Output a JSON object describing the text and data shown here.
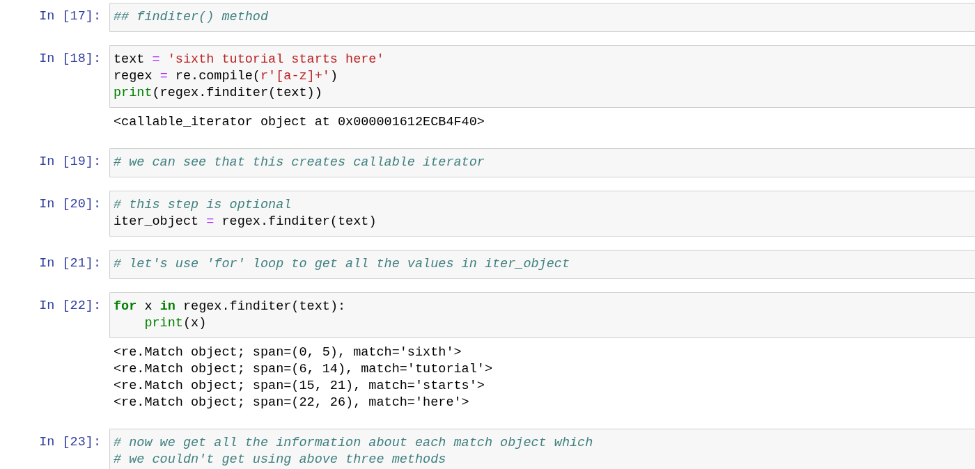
{
  "cells": [
    {
      "prompt": "In [17]:",
      "input": [
        [
          {
            "kind": "comment",
            "text": "## finditer() method"
          }
        ]
      ]
    },
    {
      "prompt": "In [18]:",
      "input": [
        [
          {
            "kind": "name",
            "text": "text "
          },
          {
            "kind": "operator",
            "text": "="
          },
          {
            "kind": "string",
            "text": " 'sixth tutorial starts here'"
          }
        ],
        [
          {
            "kind": "name",
            "text": "regex "
          },
          {
            "kind": "operator",
            "text": "="
          },
          {
            "kind": "name",
            "text": " re.compile("
          },
          {
            "kind": "string",
            "text": "r'[a-z]+'"
          },
          {
            "kind": "name",
            "text": ")"
          }
        ],
        [
          {
            "kind": "builtin",
            "text": "print"
          },
          {
            "kind": "name",
            "text": "(regex.finditer(text))"
          }
        ]
      ],
      "output": [
        "<callable_iterator object at 0x000001612ECB4F40>"
      ]
    },
    {
      "prompt": "In [19]:",
      "input": [
        [
          {
            "kind": "comment",
            "text": "# we can see that this creates callable iterator"
          }
        ]
      ]
    },
    {
      "prompt": "In [20]:",
      "input": [
        [
          {
            "kind": "comment",
            "text": "# this step is optional"
          }
        ],
        [
          {
            "kind": "name",
            "text": "iter_object "
          },
          {
            "kind": "operator",
            "text": "="
          },
          {
            "kind": "name",
            "text": " regex.finditer(text)"
          }
        ]
      ]
    },
    {
      "prompt": "In [21]:",
      "input": [
        [
          {
            "kind": "comment",
            "text": "# let's use 'for' loop to get all the values in iter_object"
          }
        ]
      ]
    },
    {
      "prompt": "In [22]:",
      "input": [
        [
          {
            "kind": "keyword",
            "text": "for"
          },
          {
            "kind": "name",
            "text": " x "
          },
          {
            "kind": "keyword",
            "text": "in"
          },
          {
            "kind": "name",
            "text": " regex.finditer(text):"
          }
        ],
        [
          {
            "kind": "builtin",
            "text": "    print"
          },
          {
            "kind": "name",
            "text": "(x)"
          }
        ]
      ],
      "output": [
        "<re.Match object; span=(0, 5), match='sixth'>",
        "<re.Match object; span=(6, 14), match='tutorial'>",
        "<re.Match object; span=(15, 21), match='starts'>",
        "<re.Match object; span=(22, 26), match='here'>"
      ]
    },
    {
      "prompt": "In [23]:",
      "input": [
        [
          {
            "kind": "comment",
            "text": "# now we get all the information about each match object which"
          }
        ],
        [
          {
            "kind": "comment",
            "text": "# we couldn't get using above three methods"
          }
        ]
      ]
    }
  ]
}
